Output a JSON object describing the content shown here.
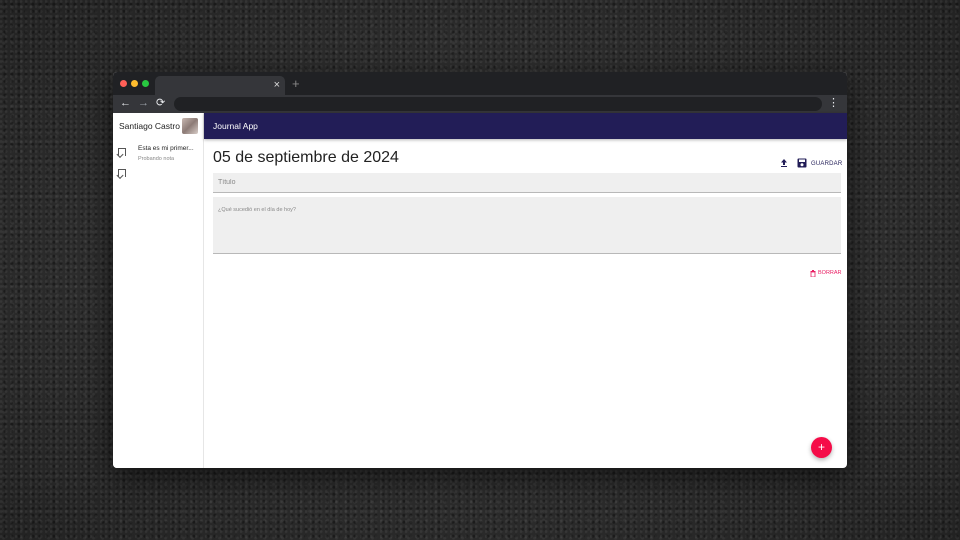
{
  "browser": {
    "tab_close": "×",
    "new_tab": "+",
    "back": "←",
    "forward": "→",
    "reload": "⟳",
    "menu": "⋮"
  },
  "sidebar": {
    "user_name": "Santiago Castro",
    "notes": [
      {
        "title": "Esta es mi primer...",
        "subtitle": "Probando nota"
      },
      {
        "title": "",
        "subtitle": ""
      }
    ]
  },
  "appbar": {
    "title": "Journal App"
  },
  "editor": {
    "date": "05 de septiembre de 2024",
    "save_label": "GUARDAR",
    "title_placeholder": "Título",
    "body_placeholder": "¿Qué sucedió en el día de hoy?",
    "delete_label": "BORRAR",
    "fab_label": "+"
  },
  "colors": {
    "appbar": "#221d57",
    "accent": "#f50c48",
    "delete": "#e91e63"
  },
  "icons": {
    "upload": "upload-icon",
    "save": "save-icon",
    "delete": "trash-icon",
    "note": "bookmark-icon"
  }
}
